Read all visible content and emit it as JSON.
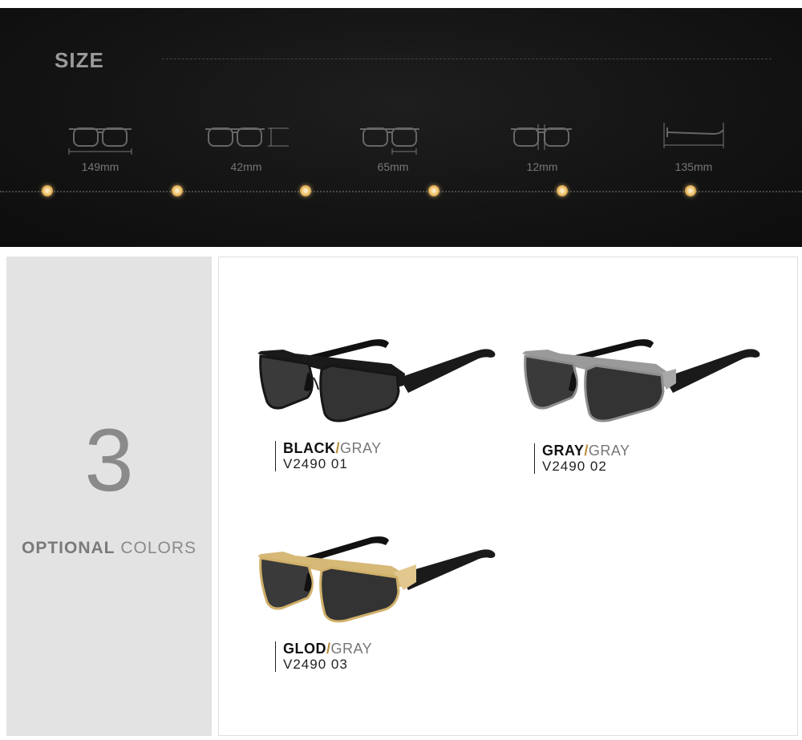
{
  "size_section": {
    "title": "SIZE",
    "dimensions": [
      {
        "value": "149mm",
        "icon": "frame-width-icon"
      },
      {
        "value": "42mm",
        "icon": "lens-width-icon"
      },
      {
        "value": "65mm",
        "icon": "lens-height-icon"
      },
      {
        "value": "12mm",
        "icon": "bridge-width-icon"
      },
      {
        "value": "135mm",
        "icon": "temple-length-icon"
      }
    ]
  },
  "colors_section": {
    "count": "3",
    "label_strong": "OPTIONAL",
    "label_light": "COLORS"
  },
  "products": [
    {
      "frame": "BLACK",
      "slash": "/",
      "lens": "GRAY",
      "model": "V2490  01",
      "frame_color": "#1a1a1a"
    },
    {
      "frame": "GRAY",
      "slash": "/",
      "lens": "GRAY",
      "model": "V2490  02",
      "frame_color": "#9a9a9a"
    },
    {
      "frame": "GLOD",
      "slash": "/",
      "lens": "GRAY",
      "model": "V2490  03",
      "frame_color": "#d6b877"
    }
  ],
  "accent_color": "#f2c878"
}
